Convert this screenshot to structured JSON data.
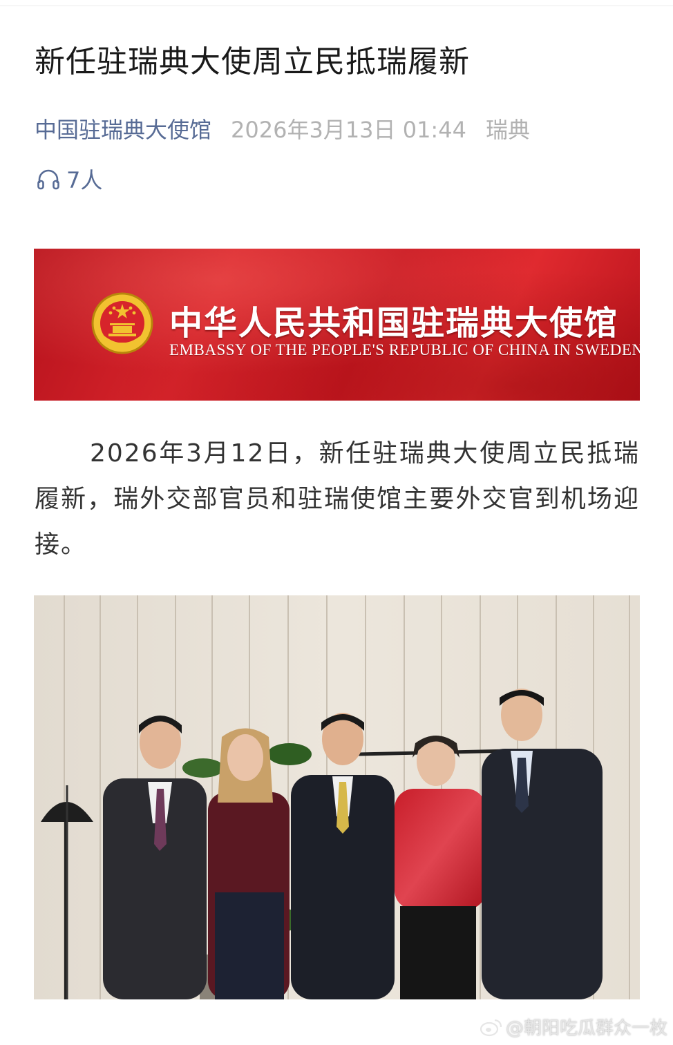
{
  "article": {
    "title": "新任驻瑞典大使周立民抵瑞履新",
    "source": "中国驻瑞典大使馆",
    "date": "2026年3月13日 01:44",
    "region": "瑞典",
    "listen_count": "7人",
    "paragraph": "2026年3月12日，新任驻瑞典大使周立民抵瑞履新，瑞外交部官员和驻瑞使馆主要外交官到机场迎接。"
  },
  "banner": {
    "title_cn": "中华人民共和国驻瑞典大使馆",
    "title_en": "EMBASSY OF THE PEOPLE'S REPUBLIC OF CHINA IN SWEDEN"
  },
  "watermark": {
    "text": "@朝阳吃瓜群众一枚"
  },
  "icons": {
    "listen": "headphones-icon",
    "emblem": "national-emblem-icon",
    "watermark": "weibo-logo-icon"
  },
  "colors": {
    "link": "#576b95",
    "meta": "#b2b2b2",
    "banner_red": "#d7242b",
    "emblem_gold": "#f2c230"
  }
}
